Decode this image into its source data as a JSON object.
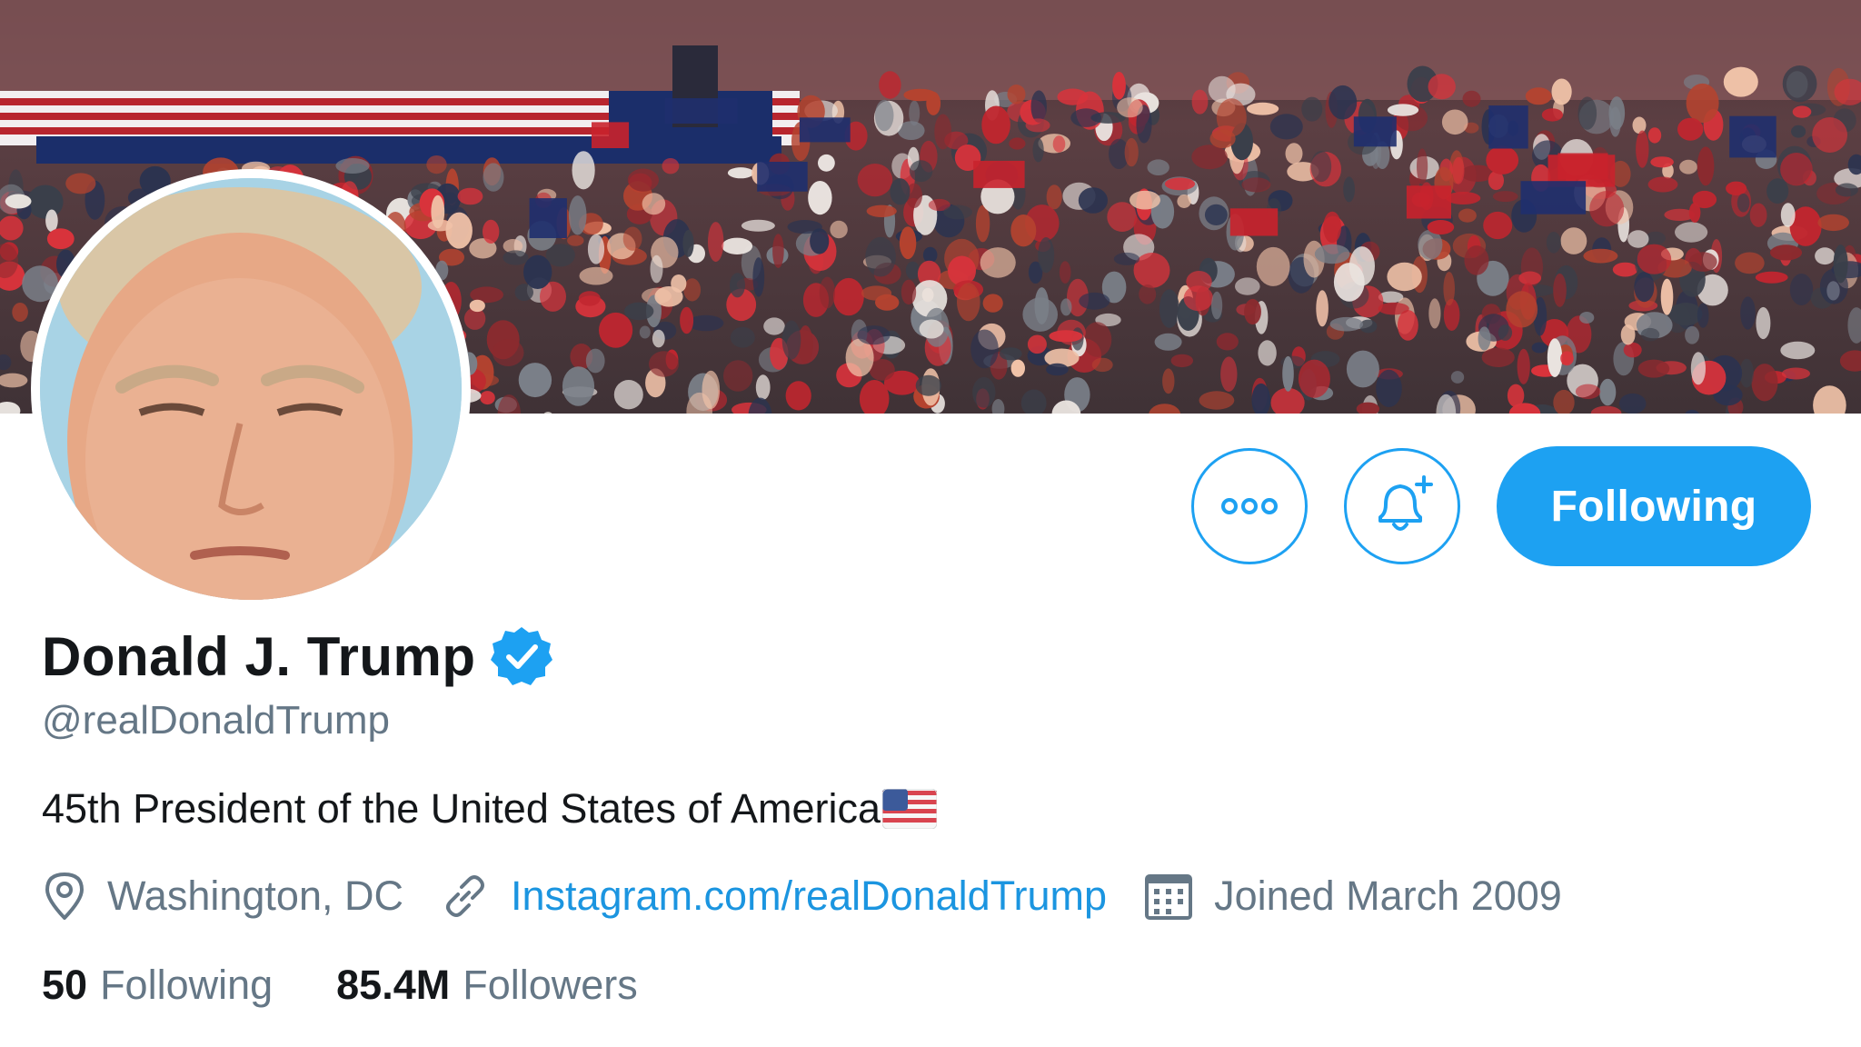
{
  "profile": {
    "display_name": "Donald J. Trump",
    "handle": "@realDonaldTrump",
    "bio": "45th President of the United States of America",
    "location": "Washington, DC",
    "website": "Instagram.com/realDonaldTrump",
    "joined": "Joined March 2009"
  },
  "actions": {
    "following_label": "Following"
  },
  "stats": {
    "following_count": "50",
    "following_label": "Following",
    "followers_count": "85.4M",
    "followers_label": "Followers"
  },
  "icons": {
    "more": "more-dots-icon",
    "bell": "notification-bell-icon",
    "verified": "verified-badge-icon",
    "location": "location-pin-icon",
    "link": "link-icon",
    "calendar": "calendar-icon",
    "flag": "us-flag-emoji"
  },
  "colors": {
    "accent": "#1da1f2",
    "link": "#1b95e0",
    "primary_text": "#14171a",
    "secondary_text": "#657786"
  }
}
